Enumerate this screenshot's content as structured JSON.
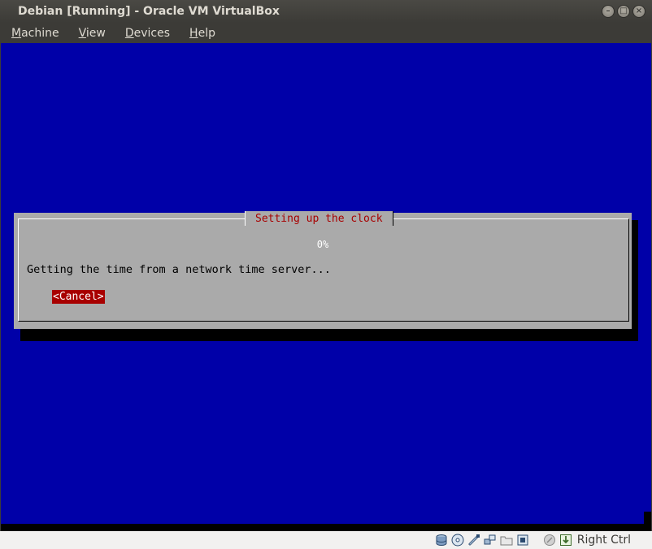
{
  "window": {
    "title": "Debian [Running] - Oracle VM VirtualBox"
  },
  "menu": [
    {
      "label": "Machine",
      "mnemonic": "M",
      "rest": "achine"
    },
    {
      "label": "View",
      "mnemonic": "V",
      "rest": "iew"
    },
    {
      "label": "Devices",
      "mnemonic": "D",
      "rest": "evices"
    },
    {
      "label": "Help",
      "mnemonic": "H",
      "rest": "elp"
    }
  ],
  "installer": {
    "dialog_title": "Setting up the clock",
    "progress_percent": 0,
    "progress_label": "0%",
    "message": "Getting the time from a network time server...",
    "cancel_label": "<Cancel>"
  },
  "statusbar": {
    "icons": [
      "hard-disk-icon",
      "optical-drive-icon",
      "usb-icon",
      "network-icon",
      "shared-folders-icon",
      "video-capture-icon",
      "mouse-integration-icon",
      "keyboard-capture-icon"
    ],
    "host_key": "Right Ctrl"
  },
  "colors": {
    "vm_background": "#0000a8",
    "dialog_background": "#aaaaaa",
    "dialog_title": "#a80000",
    "cancel_button": "#a80000"
  }
}
